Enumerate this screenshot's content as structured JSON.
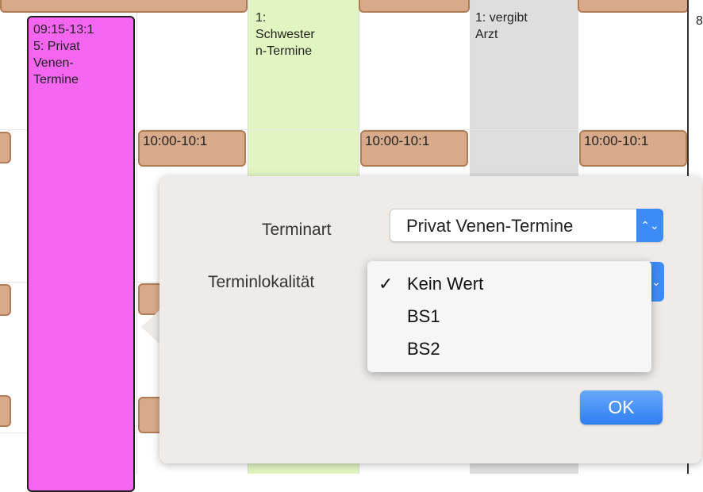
{
  "calendar": {
    "pink_block_text": "09:15-13:1\n5: Privat\nVenen-\nTermine",
    "green_col_text": "1:\nSchwester\nn-Termine",
    "grey_col_text": "1: vergibt\nArzt",
    "appt_label": "10:00-10:1",
    "right_edge_char": "8",
    "colors": {
      "pink": "#f466f0",
      "green": "#e1f5c1",
      "grey": "#dedede",
      "appt": "#d8aa8a"
    }
  },
  "dialog": {
    "terminart_label": "Terminart",
    "terminart_value": "Privat Venen-Termine",
    "terminlokalitaet_label": "Terminlokalität",
    "dropdown": {
      "check": "✓",
      "options": [
        "Kein Wert",
        "BS1",
        "BS2"
      ],
      "selected": "Kein Wert"
    },
    "ok_label": "OK",
    "accent": "#3d8bf7"
  }
}
